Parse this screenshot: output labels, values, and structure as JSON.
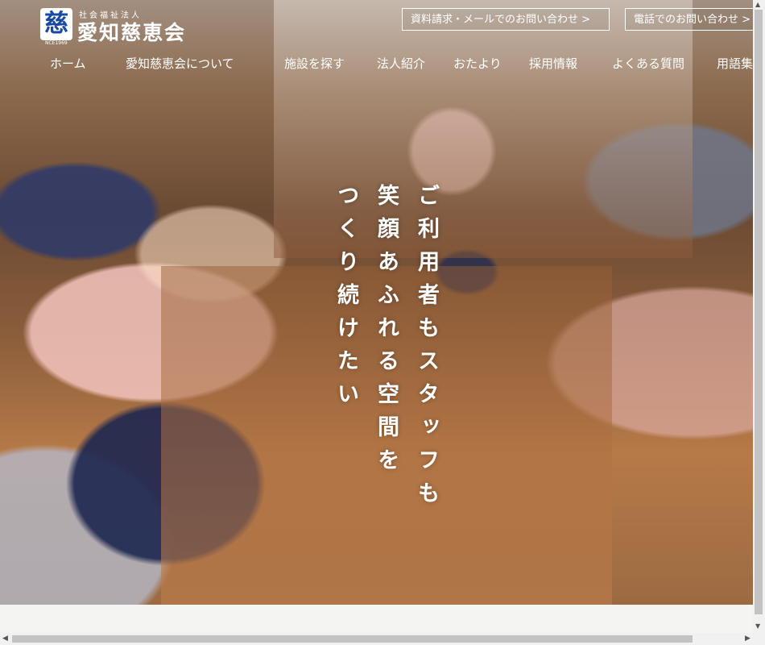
{
  "logo": {
    "mark": "慈",
    "established": "NCE1969",
    "sub": "社会福祉法人",
    "name": "愛知慈恵会"
  },
  "header": {
    "cta_mail": "資料請求・メールでのお問い合わせ >",
    "cta_phone": "電話でのお問い合わせ >"
  },
  "nav": {
    "items": [
      "ホーム",
      "愛知慈恵会について",
      "施設を探す",
      "法人紹介",
      "おたより",
      "採用情報",
      "よくある質問",
      "用語集"
    ]
  },
  "hero": {
    "lines": [
      "ご利用者もスタッフも",
      "笑顔あふれる空間を",
      "つくり続けたい"
    ]
  },
  "scrollbars": {
    "up": "▲",
    "down": "▼",
    "left": "◀",
    "right": "▶"
  }
}
